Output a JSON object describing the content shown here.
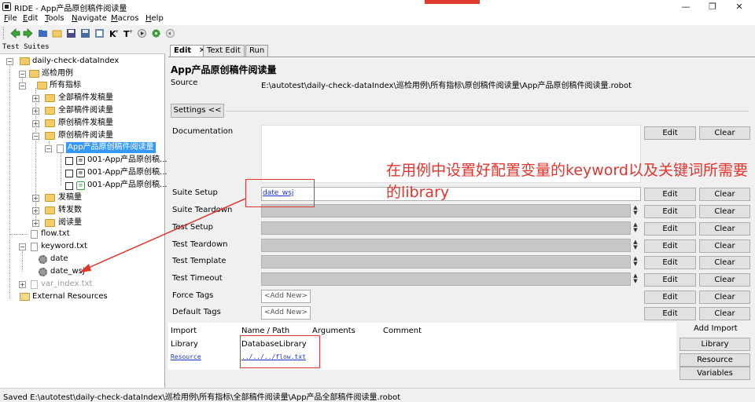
{
  "window": {
    "title": "RIDE - App产品原创稿件阅读量",
    "controls": [
      "—",
      "❐",
      "✕"
    ]
  },
  "menu": [
    {
      "hot": "F",
      "rest": "ile"
    },
    {
      "hot": "E",
      "rest": "dit"
    },
    {
      "hot": "T",
      "rest": "ools"
    },
    {
      "hot": "N",
      "rest": "avigate"
    },
    {
      "hot": "M",
      "rest": "acros"
    },
    {
      "hot": "H",
      "rest": "elp"
    }
  ],
  "toolbar_icons": [
    "back-arrow-icon",
    "forward-arrow-icon",
    "open-folder-icon",
    "open-directory-icon",
    "save-icon",
    "save-all-icon",
    "open-resource-icon",
    "new-keyword-icon",
    "new-testcase-icon",
    "run-icon",
    "settings-icon",
    "stop-icon"
  ],
  "tree": {
    "header": "Test Suites",
    "nodes": [
      {
        "label": "daily-check-dataIndex",
        "kind": "folder",
        "exp": "−"
      },
      {
        "label": "巡检用例",
        "kind": "folder",
        "exp": "−"
      },
      {
        "label": "所有指标",
        "kind": "folder",
        "exp": "−"
      },
      {
        "label": "全部稿件发稿量",
        "kind": "folder",
        "exp": "+"
      },
      {
        "label": "全部稿件阅读量",
        "kind": "folder",
        "exp": "+"
      },
      {
        "label": "原创稿件发稿量",
        "kind": "folder",
        "exp": "+"
      },
      {
        "label": "原创稿件阅读量",
        "kind": "folder",
        "exp": "−"
      },
      {
        "label": "App产品原创稿件阅读量",
        "kind": "file",
        "exp": "−",
        "selected": true
      },
      {
        "label": "001-App产品原创稿...",
        "kind": "test"
      },
      {
        "label": "001-App产品原创稿...",
        "kind": "test"
      },
      {
        "label": "001-App产品原创稿...",
        "kind": "test-green"
      },
      {
        "label": "发稿量",
        "kind": "folder",
        "exp": "+"
      },
      {
        "label": "转发数",
        "kind": "folder",
        "exp": "+"
      },
      {
        "label": "阅读量",
        "kind": "folder",
        "exp": "+"
      },
      {
        "label": "flow.txt",
        "kind": "resource"
      },
      {
        "label": "keyword.txt",
        "kind": "resource",
        "exp": "−"
      },
      {
        "label": "date",
        "kind": "keyword"
      },
      {
        "label": "date_wsj",
        "kind": "keyword"
      },
      {
        "label": "var_index.txt",
        "kind": "resource-gray",
        "exp": "+"
      },
      {
        "label": "External Resources",
        "kind": "external"
      }
    ]
  },
  "tabs": [
    {
      "label": "Edit",
      "closable": true,
      "active": true
    },
    {
      "label": "Text Edit"
    },
    {
      "label": "Run"
    }
  ],
  "editor": {
    "suite_name": "App产品原创稿件阅读量",
    "source_label": "Source",
    "source_path": "E:\\autotest\\daily-check-dataIndex\\巡检用例\\所有指标\\原创稿件阅读量\\App产品原创稿件阅读量.robot",
    "settings_button": "Settings <<",
    "documentation_label": "Documentation",
    "settings": [
      {
        "label": "Suite Setup",
        "value": "date_wsj"
      },
      {
        "label": "Suite Teardown",
        "value": ""
      },
      {
        "label": "Test Setup",
        "value": ""
      },
      {
        "label": "Test Teardown",
        "value": ""
      },
      {
        "label": "Test Template",
        "value": ""
      },
      {
        "label": "Test Timeout",
        "value": ""
      }
    ],
    "tags": [
      {
        "label": "Force Tags",
        "placeholder": "<Add New>"
      },
      {
        "label": "Default Tags",
        "placeholder": "<Add New>"
      }
    ],
    "edit_button": "Edit",
    "clear_button": "Clear"
  },
  "imports": {
    "headers": [
      "Import",
      "Name / Path",
      "Arguments",
      "Comment"
    ],
    "rows": [
      {
        "type": "Library",
        "name": "DatabaseLibrary"
      },
      {
        "type": "Resource",
        "name": "../../../flow.txt"
      }
    ],
    "add_import_label": "Add Import",
    "buttons": [
      "Library",
      "Resource",
      "Variables"
    ]
  },
  "annotation": {
    "note": "在用例中设置好配置变量的keyword以及关键词所需要的library"
  },
  "status": "Saved E:\\autotest\\daily-check-dataIndex\\巡检用例\\所有指标\\全部稿件阅读量\\App产品全部稿件阅读量.robot",
  "colors": {
    "accent_red": "#e3342f",
    "selection_blue": "#3399ff",
    "link_blue": "#1a35c7"
  }
}
